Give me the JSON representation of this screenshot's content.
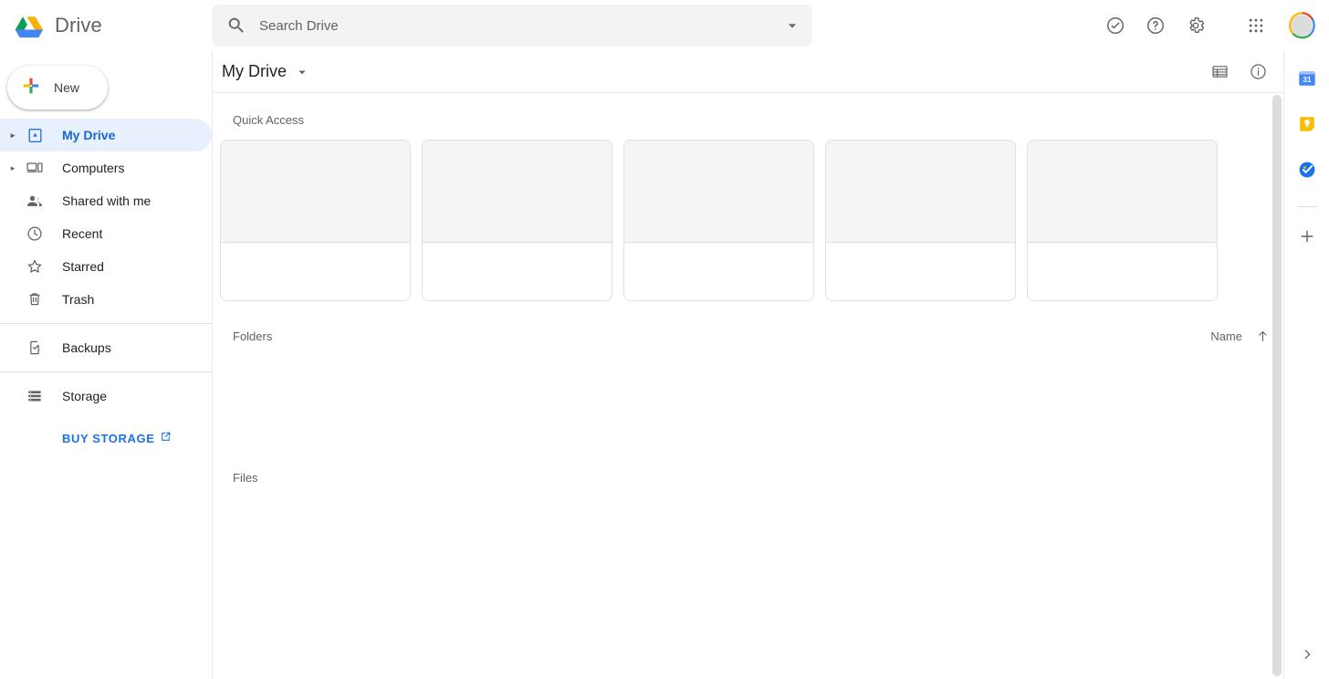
{
  "app": {
    "brand_name": "Drive",
    "logo_icon": "drive-logo-icon"
  },
  "search": {
    "placeholder": "Search Drive",
    "value": "",
    "icon": "search-icon",
    "options_icon": "chevron-down-icon"
  },
  "topbar_actions": [
    {
      "name": "support-icon",
      "label": "Support"
    },
    {
      "name": "help-icon",
      "label": "Help"
    },
    {
      "name": "settings-gear-icon",
      "label": "Settings"
    },
    {
      "name": "google-apps-grid-icon",
      "label": "Google apps"
    },
    {
      "name": "account-avatar",
      "label": "Account"
    }
  ],
  "sidebar": {
    "new_button": {
      "label": "New",
      "icon": "plus-icon"
    },
    "items": [
      {
        "label": "My Drive",
        "icon": "my-drive-icon",
        "active": true,
        "expandable": true
      },
      {
        "label": "Computers",
        "icon": "computer-icon",
        "active": false,
        "expandable": true
      },
      {
        "label": "Shared with me",
        "icon": "people-icon",
        "active": false,
        "expandable": false
      },
      {
        "label": "Recent",
        "icon": "clock-icon",
        "active": false,
        "expandable": false
      },
      {
        "label": "Starred",
        "icon": "star-icon",
        "active": false,
        "expandable": false
      },
      {
        "label": "Trash",
        "icon": "trash-icon",
        "active": false,
        "expandable": false
      },
      {
        "label": "Backups",
        "icon": "backups-icon",
        "active": false,
        "expandable": false
      },
      {
        "label": "Storage",
        "icon": "storage-icon",
        "active": false,
        "expandable": false
      }
    ],
    "buy_storage": {
      "label": "BUY STORAGE",
      "icon": "external-link-icon"
    }
  },
  "toolbar": {
    "breadcrumb": "My Drive",
    "breadcrumb_caret": "chevron-down-icon",
    "list_view_icon": "list-view-icon",
    "details_icon": "info-circle-icon"
  },
  "main": {
    "quick_access_label": "Quick Access",
    "quick_access_cards": [
      {
        "name": "quick-access-card-1"
      },
      {
        "name": "quick-access-card-2"
      },
      {
        "name": "quick-access-card-3"
      },
      {
        "name": "quick-access-card-4"
      },
      {
        "name": "quick-access-card-5"
      }
    ],
    "folders_label": "Folders",
    "sort_label": "Name",
    "sort_direction_icon": "arrow-up-icon",
    "files_label": "Files"
  },
  "side_rail": {
    "apps": [
      {
        "name": "google-calendar-icon",
        "label": "Calendar"
      },
      {
        "name": "google-keep-icon",
        "label": "Keep"
      },
      {
        "name": "google-tasks-icon",
        "label": "Tasks"
      }
    ],
    "add_button_icon": "plus-icon",
    "expand_icon": "chevron-right-icon"
  },
  "colors": {
    "accent_blue": "#1a73e8",
    "active_bg": "#e8f0fe",
    "google_red": "#ea4335",
    "google_yellow": "#fbbc04",
    "google_green": "#34a853",
    "google_blue": "#4285f4",
    "text_secondary": "#5f6368"
  }
}
